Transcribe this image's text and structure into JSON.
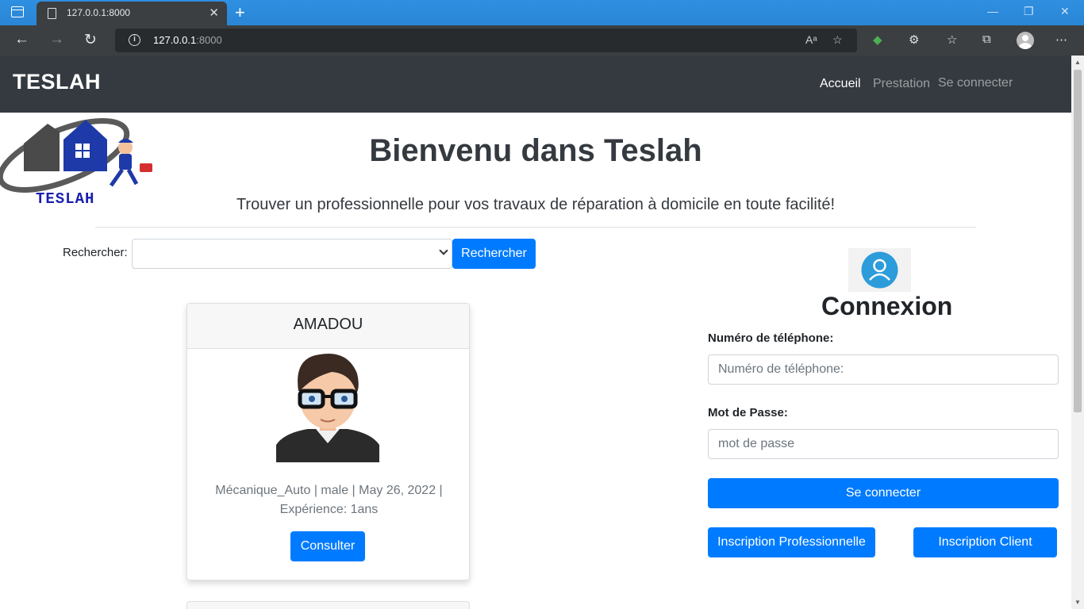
{
  "browser": {
    "tab_title": "127.0.0.1:8000",
    "url_host": "127.0.0.1",
    "url_port": ":8000"
  },
  "navbar": {
    "brand": "TESLAH",
    "links": [
      "Accueil",
      "Prestation",
      "Se connecter"
    ]
  },
  "logo": {
    "text": "TESLAH"
  },
  "hero": {
    "title": "Bienvenu dans Teslah",
    "subtitle": "Trouver un professionnelle pour vos travaux de réparation à domicile en toute facilité!"
  },
  "search": {
    "label": "Rechercher:",
    "selected": "",
    "button": "Rechercher"
  },
  "cards": [
    {
      "name": "AMADOU",
      "details": "Mécanique_Auto | male | May 26, 2022 |",
      "experience": "Expérience: 1ans",
      "button": "Consulter"
    }
  ],
  "login": {
    "title": "Connexion",
    "phone_label": "Numéro de téléphone:",
    "phone_placeholder": "Numéro de téléphone:",
    "password_label": "Mot de Passe:",
    "password_placeholder": "mot de passe",
    "submit": "Se connecter",
    "register_pro": "Inscription Professionnelle",
    "register_client": "Inscription Client"
  },
  "colors": {
    "primary": "#007bff",
    "navbar": "#343a40",
    "browser_accent": "#2b88d8"
  }
}
